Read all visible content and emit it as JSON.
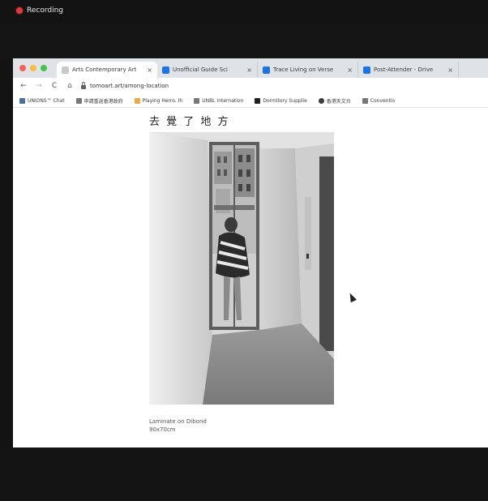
{
  "recording": {
    "label": "Recording"
  },
  "browser": {
    "tabs": [
      {
        "title": "Arts Contemporary Art",
        "icon": "site-favicon",
        "active": true
      },
      {
        "title": "Unofficial Guide Sci",
        "icon": "doc-favicon",
        "active": false
      },
      {
        "title": "Trace Living on Verse",
        "icon": "doc-favicon",
        "active": false
      },
      {
        "title": "Post-Attender - Drive",
        "icon": "doc-favicon",
        "active": false
      }
    ],
    "tab_close": "×",
    "toolbar": {
      "back": "←",
      "forward": "→",
      "reload": "C",
      "home": "⌂",
      "url": "tomoart.art/among-location"
    },
    "bookmarks": [
      {
        "label": "UNIONS™ Chat",
        "icon": "blue"
      },
      {
        "label": "申請重返香港政府",
        "icon": "gray"
      },
      {
        "label": "Playing Herro. Ih",
        "icon": "folder"
      },
      {
        "label": "UNBL Internation",
        "icon": "gray"
      },
      {
        "label": "Dormitory Supplie",
        "icon": "doc"
      },
      {
        "label": "香港天文台",
        "icon": "star"
      },
      {
        "label": "Conventio",
        "icon": "gray"
      }
    ]
  },
  "page": {
    "heading": "去 覺 了 地 方",
    "caption_line1": "Laminate on Dibond",
    "caption_line2": "90x70cm"
  }
}
